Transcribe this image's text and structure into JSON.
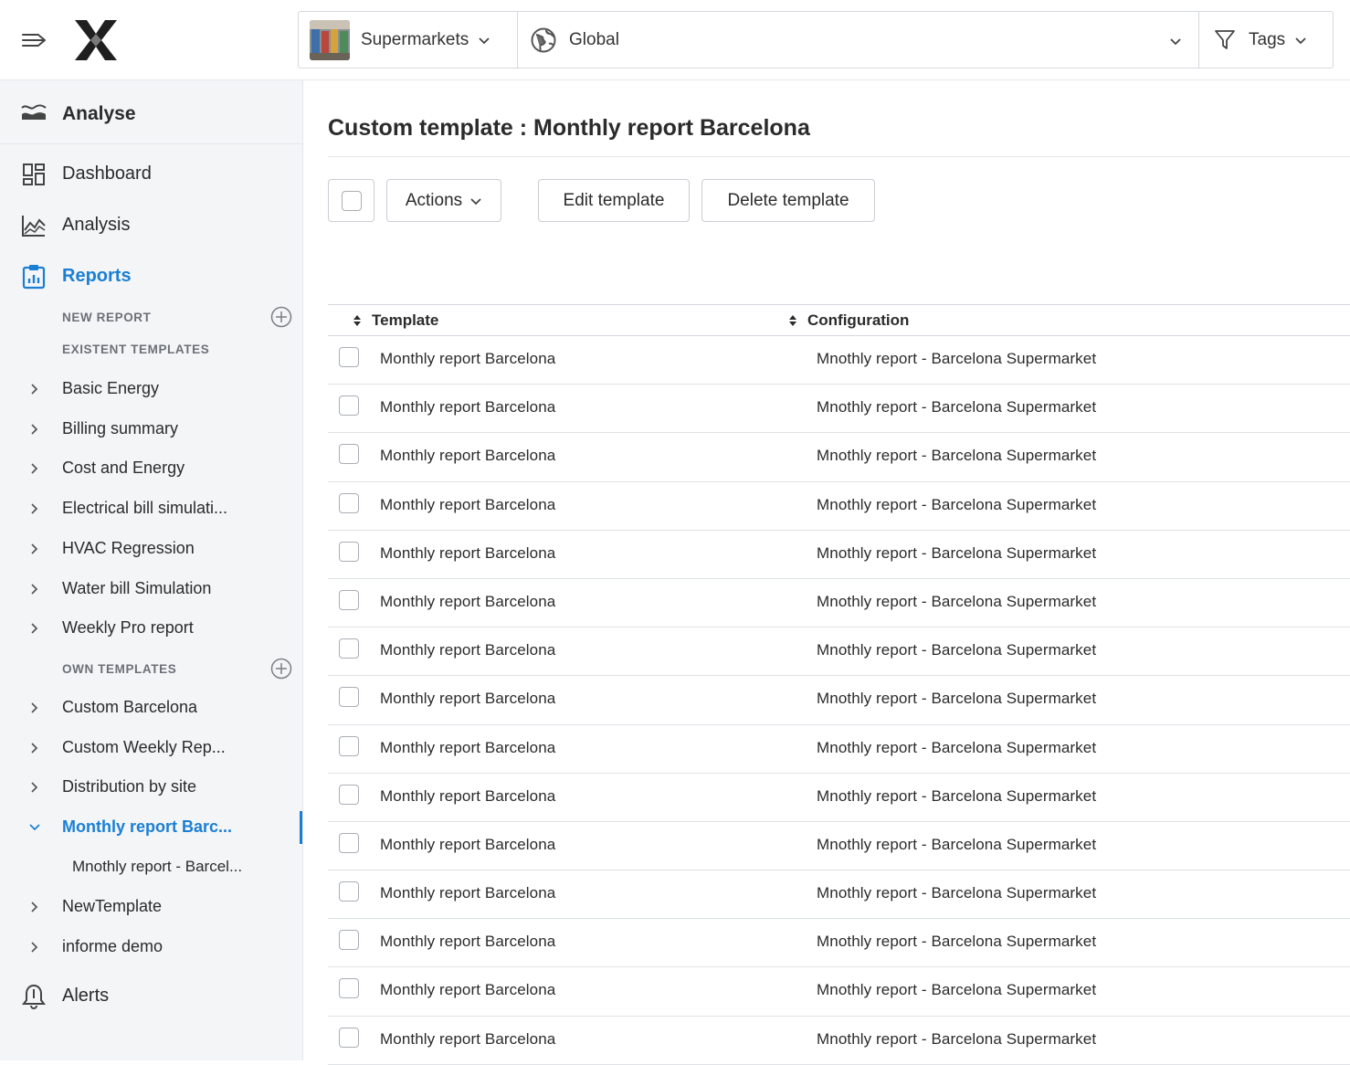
{
  "header": {
    "site_selector": {
      "label": "Supermarkets"
    },
    "scope_selector": {
      "label": "Global"
    },
    "tags_filter": {
      "label": "Tags"
    }
  },
  "sidebar": {
    "sections": {
      "analyse": "Analyse",
      "dashboard": "Dashboard",
      "analysis": "Analysis",
      "reports": "Reports",
      "alerts": "Alerts"
    },
    "captions": {
      "new_report": "NEW REPORT",
      "existent_templates": "EXISTENT TEMPLATES",
      "own_templates": "OWN TEMPLATES"
    },
    "existent_templates": [
      "Basic Energy",
      "Billing summary",
      "Cost and Energy",
      "Electrical bill simulati...",
      "HVAC Regression",
      "Water bill Simulation",
      "Weekly Pro report"
    ],
    "own_templates": [
      "Custom Barcelona",
      "Custom Weekly Rep...",
      "Distribution by site",
      "Monthly report Barc...",
      "NewTemplate",
      "informe demo"
    ],
    "active_template_child": "Mnothly report - Barcel..."
  },
  "main": {
    "title": "Custom template : Monthly report Barcelona",
    "toolbar": {
      "actions_label": "Actions",
      "edit_label": "Edit template",
      "delete_label": "Delete template"
    },
    "table": {
      "columns": [
        "Template",
        "Configuration"
      ],
      "rows": [
        [
          "Monthly report Barcelona",
          "Mnothly report - Barcelona Supermarket"
        ],
        [
          "Monthly report Barcelona",
          "Mnothly report - Barcelona Supermarket"
        ],
        [
          "Monthly report Barcelona",
          "Mnothly report - Barcelona Supermarket"
        ],
        [
          "Monthly report Barcelona",
          "Mnothly report - Barcelona Supermarket"
        ],
        [
          "Monthly report Barcelona",
          "Mnothly report - Barcelona Supermarket"
        ],
        [
          "Monthly report Barcelona",
          "Mnothly report - Barcelona Supermarket"
        ],
        [
          "Monthly report Barcelona",
          "Mnothly report - Barcelona Supermarket"
        ],
        [
          "Monthly report Barcelona",
          "Mnothly report - Barcelona Supermarket"
        ],
        [
          "Monthly report Barcelona",
          "Mnothly report - Barcelona Supermarket"
        ],
        [
          "Monthly report Barcelona",
          "Mnothly report - Barcelona Supermarket"
        ],
        [
          "Monthly report Barcelona",
          "Mnothly report - Barcelona Supermarket"
        ],
        [
          "Monthly report Barcelona",
          "Mnothly report - Barcelona Supermarket"
        ],
        [
          "Monthly report Barcelona",
          "Mnothly report - Barcelona Supermarket"
        ],
        [
          "Monthly report Barcelona",
          "Mnothly report - Barcelona Supermarket"
        ],
        [
          "Monthly report Barcelona",
          "Mnothly report - Barcelona Supermarket"
        ]
      ]
    }
  },
  "colors": {
    "accent": "#1a7fd4",
    "sidebar_bg": "#f4f5f7",
    "text": "#2b2b2b"
  }
}
